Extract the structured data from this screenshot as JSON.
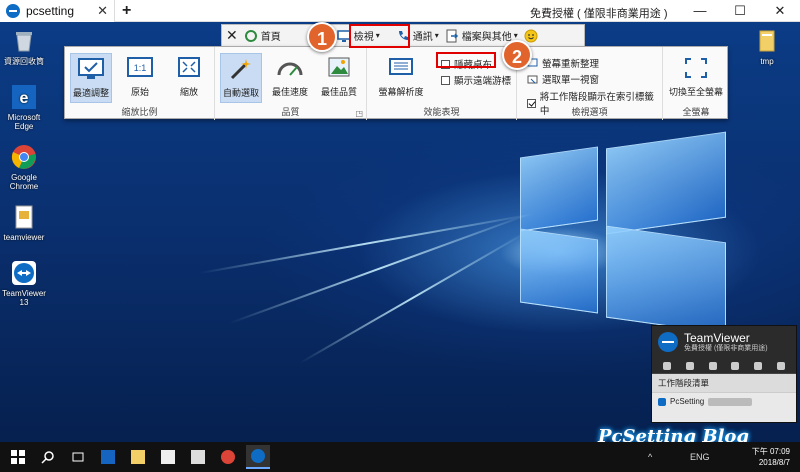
{
  "window": {
    "tab_label": "pcsetting",
    "tab_close": "✕",
    "add_tab": "+",
    "license_text": "免費授權 ( 僅限非商業用途 )",
    "minimize": "—",
    "maximize": "☐",
    "close": "✕"
  },
  "desktop_icons": [
    {
      "label": "資源回收筒"
    },
    {
      "label": "Microsoft Edge"
    },
    {
      "label": "Google Chrome"
    },
    {
      "label": "teamviewer"
    },
    {
      "label": "TeamViewer 13"
    },
    {
      "label": "tmp"
    }
  ],
  "ribbon_top": {
    "close": "✕",
    "home": "首頁",
    "view": "檢視",
    "comm": "通訊",
    "files": "檔案與其他",
    "view_arrow": "▾",
    "comm_arrow": "▾",
    "files_arrow": "▾"
  },
  "ribbon": {
    "scale_group": "縮放比例",
    "scale_best": "最適調整",
    "scale_original": "原始",
    "scale_zoom": "縮放",
    "scale_original_glyph": "1:1",
    "quality_group": "品質",
    "quality_auto": "自動選取",
    "quality_speed": "最佳速度",
    "quality_best": "最佳品質",
    "quality_expand": "◳",
    "perf_group": "效能表現",
    "resolution": "螢幕解析度",
    "hide_wallpaper": "隱藏桌布",
    "show_cursor": "顯示遠端游標",
    "monitor_group": "檢視選項",
    "refresh": "螢幕重新整理",
    "select_window": "選取單一視窗",
    "show_taskbar": "將工作階段顯示在索引標籤中",
    "fullscreen_group": "全螢幕",
    "fullscreen": "切換至全螢幕"
  },
  "badges": [
    "1",
    "2"
  ],
  "tv_panel": {
    "brand": "TeamViewer",
    "sub": "免費授權 (僅限非商業用途)",
    "list_title": "工作階段清單",
    "session": "PcSetting"
  },
  "watermark": "PcSetting Blog",
  "taskbar": {
    "lang": "ENG",
    "time": "下午 07:09",
    "date": "2018/8/7"
  },
  "colors": {
    "accent_blue": "#0e6cc4",
    "badge_orange": "#e0642b",
    "highlight_red": "#e00000"
  }
}
